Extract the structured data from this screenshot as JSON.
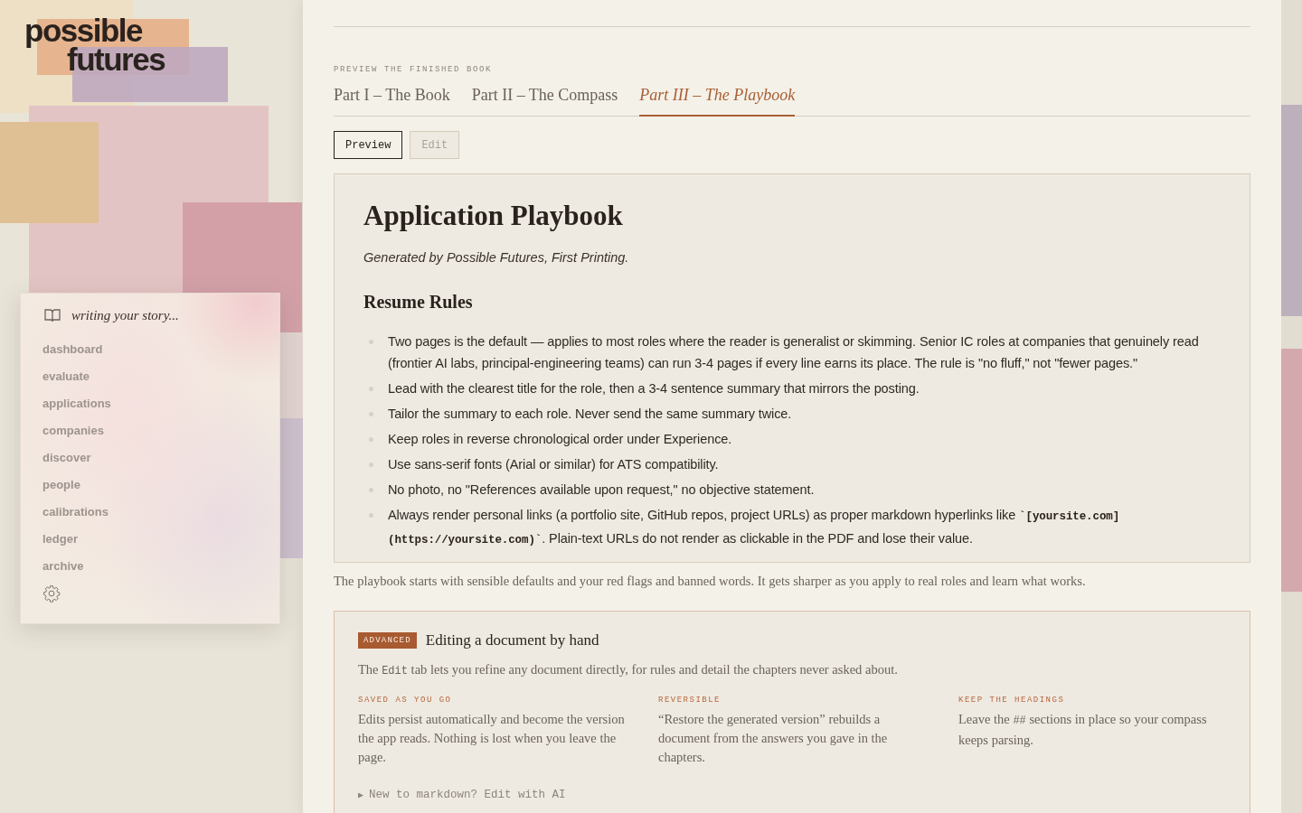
{
  "brand": {
    "line_1": "possible",
    "line_2": "futures"
  },
  "nav": {
    "status": "writing your story...",
    "items": [
      {
        "label": "dashboard",
        "selected": false
      },
      {
        "label": "evaluate",
        "selected": false
      },
      {
        "label": "applications",
        "selected": false
      },
      {
        "label": "companies",
        "selected": false
      },
      {
        "label": "discover",
        "selected": false
      },
      {
        "label": "people",
        "selected": false
      },
      {
        "label": "calibrations",
        "selected": false
      },
      {
        "label": "ledger",
        "selected": false
      },
      {
        "label": "archive",
        "selected": false
      }
    ]
  },
  "book": {
    "eyebrow": "PREVIEW THE FINISHED BOOK",
    "tabs": [
      {
        "label": "Part I – The Book",
        "selected": false
      },
      {
        "label": "Part II – The Compass",
        "selected": false
      },
      {
        "label": "Part III – The Playbook",
        "selected": true
      }
    ],
    "modes": [
      {
        "label": "Preview",
        "selected": true
      },
      {
        "label": "Edit",
        "selected": false
      }
    ],
    "document": {
      "title": "Application Playbook",
      "subtitle": "Generated by Possible Futures, First Printing.",
      "section": "Resume Rules",
      "bullets": [
        [
          {
            "kind": "plain",
            "text": "Two pages is the default — applies to most roles where the reader is generalist or skimming. Senior IC roles at companies that genuinely read (frontier AI labs, principal-engineering teams) can run 3-4 pages if every line earns its place. The rule is \"no fluff,\" not \"fewer pages.\""
          }
        ],
        [
          {
            "kind": "plain",
            "text": "Lead with the clearest title for the role, then a 3-4 sentence summary that mirrors the posting."
          }
        ],
        [
          {
            "kind": "plain",
            "text": "Tailor the summary to each role. Never send the same summary twice."
          }
        ],
        [
          {
            "kind": "plain",
            "text": "Keep roles in reverse chronological order under Experience."
          }
        ],
        [
          {
            "kind": "plain",
            "text": "Use sans-serif fonts (Arial or similar) for ATS compatibility."
          }
        ],
        [
          {
            "kind": "plain",
            "text": "No photo, no \"References available upon request,\" no objective statement."
          }
        ],
        [
          {
            "kind": "plain",
            "text": "Always render personal links (a portfolio site, GitHub repos, project URLs) as proper markdown hyperlinks like "
          },
          {
            "kind": "code",
            "text": "`[yoursite.com](https://yoursite.com)`"
          },
          {
            "kind": "plain",
            "text": ". Plain-text URLs do not render as clickable in the PDF and lose their value."
          }
        ]
      ]
    },
    "note": "The playbook starts with sensible defaults and your red flags and banned words. It gets sharper as you apply to real roles and learn what works.",
    "advanced": {
      "badge": "ADVANCED",
      "title": "Editing a document by hand",
      "intro": [
        {
          "kind": "plain",
          "text": "The "
        },
        {
          "kind": "code",
          "text": "Edit"
        },
        {
          "kind": "plain",
          "text": " tab lets you refine any document directly, for rules and detail the chapters never asked about."
        }
      ],
      "tips": [
        {
          "heading": "SAVED AS YOU GO",
          "body": [
            {
              "kind": "plain",
              "text": "Edits persist automatically and become the version the app reads. Nothing is lost when you leave the page."
            }
          ]
        },
        {
          "heading": "REVERSIBLE",
          "body": [
            {
              "kind": "plain",
              "text": "“Restore the generated version” rebuilds a document from the answers you gave in the chapters."
            }
          ]
        },
        {
          "heading": "KEEP THE HEADINGS",
          "body": [
            {
              "kind": "plain",
              "text": "Leave the "
            },
            {
              "kind": "code",
              "text": "##"
            },
            {
              "kind": "plain",
              "text": " sections in place so your compass keeps parsing."
            }
          ]
        }
      ],
      "disclosure": {
        "marker": "▶",
        "label": "New to markdown? Edit with AI",
        "expanded": false
      }
    }
  }
}
